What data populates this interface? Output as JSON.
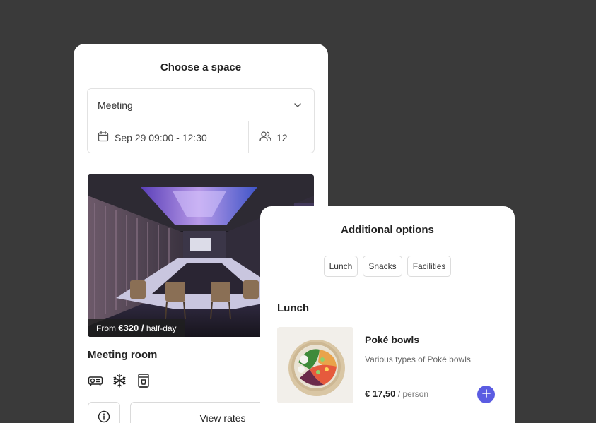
{
  "space_card": {
    "title": "Choose a space",
    "type_select": {
      "value": "Meeting",
      "icon": "chevron-down-icon"
    },
    "date_field": {
      "value": "Sep 29 09:00 - 12:30",
      "icon": "calendar-icon"
    },
    "guests_field": {
      "value": "12",
      "icon": "people-icon"
    },
    "photo": {
      "price_prefix": "From",
      "price_value": "€320 /",
      "price_suffix": "half-day"
    },
    "room_name": "Meeting room",
    "amenities": [
      "projector-icon",
      "snowflake-icon",
      "coffee-machine-icon"
    ],
    "info_button_icon": "info-icon",
    "rates_button": "View rates"
  },
  "options_card": {
    "title": "Additional options",
    "chips": [
      "Lunch",
      "Snacks",
      "Facilities"
    ],
    "section_label": "Lunch",
    "item": {
      "name": "Poké bowls",
      "description": "Various types of Poké bowls",
      "price": "€ 17,50",
      "unit": "/ person",
      "add_icon": "plus-icon"
    }
  },
  "colors": {
    "background": "#3a3a3a",
    "card": "#ffffff",
    "accent": "#5b5ce2"
  }
}
